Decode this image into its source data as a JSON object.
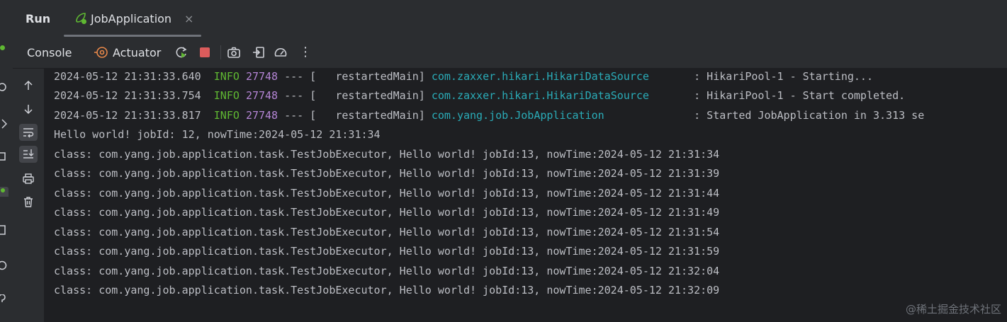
{
  "panel": {
    "title": "Run"
  },
  "tab": {
    "label": "JobApplication",
    "close": "×"
  },
  "toolbar": {
    "console_label": "Console",
    "actuator_label": "Actuator",
    "more": "⋮"
  },
  "log": [
    {
      "time": "2024-05-12 21:31:33.640",
      "level": "INFO",
      "pid": "27748",
      "sep": "--- [",
      "thread": "  restartedMain]",
      "logger": "com.zaxxer.hikari.HikariDataSource",
      "message": ": HikariPool-1 - Starting..."
    },
    {
      "time": "2024-05-12 21:31:33.754",
      "level": "INFO",
      "pid": "27748",
      "sep": "--- [",
      "thread": "  restartedMain]",
      "logger": "com.zaxxer.hikari.HikariDataSource",
      "message": ": HikariPool-1 - Start completed."
    },
    {
      "time": "2024-05-12 21:31:33.817",
      "level": "INFO",
      "pid": "27748",
      "sep": "--- [",
      "thread": "  restartedMain]",
      "logger": "com.yang.job.JobApplication",
      "message": ": Started JobApplication in 3.313 se"
    }
  ],
  "output": [
    "Hello world! jobId: 12, nowTime:2024-05-12 21:31:34",
    "class: com.yang.job.application.task.TestJobExecutor, Hello world! jobId:13, nowTime:2024-05-12 21:31:34",
    "class: com.yang.job.application.task.TestJobExecutor, Hello world! jobId:13, nowTime:2024-05-12 21:31:39",
    "class: com.yang.job.application.task.TestJobExecutor, Hello world! jobId:13, nowTime:2024-05-12 21:31:44",
    "class: com.yang.job.application.task.TestJobExecutor, Hello world! jobId:13, nowTime:2024-05-12 21:31:49",
    "class: com.yang.job.application.task.TestJobExecutor, Hello world! jobId:13, nowTime:2024-05-12 21:31:54",
    "class: com.yang.job.application.task.TestJobExecutor, Hello world! jobId:13, nowTime:2024-05-12 21:31:59",
    "class: com.yang.job.application.task.TestJobExecutor, Hello world! jobId:13, nowTime:2024-05-12 21:32:04",
    "class: com.yang.job.application.task.TestJobExecutor, Hello world! jobId:13, nowTime:2024-05-12 21:32:09"
  ],
  "watermark": "@稀土掘金技术社区",
  "colors": {
    "info": "#5fb832",
    "pid": "#b585d6",
    "logger": "#2aacb8",
    "stop": "#db5c5c",
    "run": "#5fb832"
  }
}
